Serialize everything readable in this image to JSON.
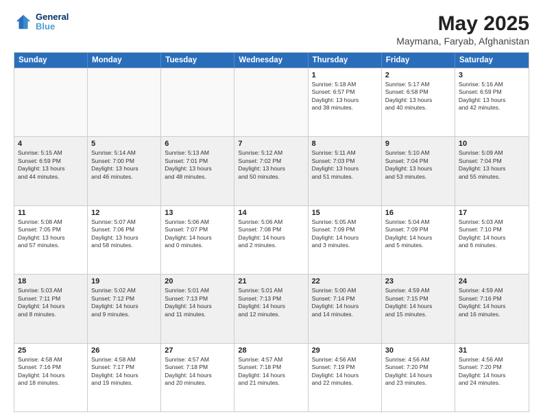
{
  "header": {
    "logo_line1": "General",
    "logo_line2": "Blue",
    "title": "May 2025",
    "subtitle": "Maymana, Faryab, Afghanistan"
  },
  "days_of_week": [
    "Sunday",
    "Monday",
    "Tuesday",
    "Wednesday",
    "Thursday",
    "Friday",
    "Saturday"
  ],
  "weeks": [
    [
      {
        "day": "",
        "text": ""
      },
      {
        "day": "",
        "text": ""
      },
      {
        "day": "",
        "text": ""
      },
      {
        "day": "",
        "text": ""
      },
      {
        "day": "1",
        "text": "Sunrise: 5:18 AM\nSunset: 6:57 PM\nDaylight: 13 hours\nand 38 minutes."
      },
      {
        "day": "2",
        "text": "Sunrise: 5:17 AM\nSunset: 6:58 PM\nDaylight: 13 hours\nand 40 minutes."
      },
      {
        "day": "3",
        "text": "Sunrise: 5:16 AM\nSunset: 6:59 PM\nDaylight: 13 hours\nand 42 minutes."
      }
    ],
    [
      {
        "day": "4",
        "text": "Sunrise: 5:15 AM\nSunset: 6:59 PM\nDaylight: 13 hours\nand 44 minutes."
      },
      {
        "day": "5",
        "text": "Sunrise: 5:14 AM\nSunset: 7:00 PM\nDaylight: 13 hours\nand 46 minutes."
      },
      {
        "day": "6",
        "text": "Sunrise: 5:13 AM\nSunset: 7:01 PM\nDaylight: 13 hours\nand 48 minutes."
      },
      {
        "day": "7",
        "text": "Sunrise: 5:12 AM\nSunset: 7:02 PM\nDaylight: 13 hours\nand 50 minutes."
      },
      {
        "day": "8",
        "text": "Sunrise: 5:11 AM\nSunset: 7:03 PM\nDaylight: 13 hours\nand 51 minutes."
      },
      {
        "day": "9",
        "text": "Sunrise: 5:10 AM\nSunset: 7:04 PM\nDaylight: 13 hours\nand 53 minutes."
      },
      {
        "day": "10",
        "text": "Sunrise: 5:09 AM\nSunset: 7:04 PM\nDaylight: 13 hours\nand 55 minutes."
      }
    ],
    [
      {
        "day": "11",
        "text": "Sunrise: 5:08 AM\nSunset: 7:05 PM\nDaylight: 13 hours\nand 57 minutes."
      },
      {
        "day": "12",
        "text": "Sunrise: 5:07 AM\nSunset: 7:06 PM\nDaylight: 13 hours\nand 58 minutes."
      },
      {
        "day": "13",
        "text": "Sunrise: 5:06 AM\nSunset: 7:07 PM\nDaylight: 14 hours\nand 0 minutes."
      },
      {
        "day": "14",
        "text": "Sunrise: 5:06 AM\nSunset: 7:08 PM\nDaylight: 14 hours\nand 2 minutes."
      },
      {
        "day": "15",
        "text": "Sunrise: 5:05 AM\nSunset: 7:09 PM\nDaylight: 14 hours\nand 3 minutes."
      },
      {
        "day": "16",
        "text": "Sunrise: 5:04 AM\nSunset: 7:09 PM\nDaylight: 14 hours\nand 5 minutes."
      },
      {
        "day": "17",
        "text": "Sunrise: 5:03 AM\nSunset: 7:10 PM\nDaylight: 14 hours\nand 6 minutes."
      }
    ],
    [
      {
        "day": "18",
        "text": "Sunrise: 5:03 AM\nSunset: 7:11 PM\nDaylight: 14 hours\nand 8 minutes."
      },
      {
        "day": "19",
        "text": "Sunrise: 5:02 AM\nSunset: 7:12 PM\nDaylight: 14 hours\nand 9 minutes."
      },
      {
        "day": "20",
        "text": "Sunrise: 5:01 AM\nSunset: 7:13 PM\nDaylight: 14 hours\nand 11 minutes."
      },
      {
        "day": "21",
        "text": "Sunrise: 5:01 AM\nSunset: 7:13 PM\nDaylight: 14 hours\nand 12 minutes."
      },
      {
        "day": "22",
        "text": "Sunrise: 5:00 AM\nSunset: 7:14 PM\nDaylight: 14 hours\nand 14 minutes."
      },
      {
        "day": "23",
        "text": "Sunrise: 4:59 AM\nSunset: 7:15 PM\nDaylight: 14 hours\nand 15 minutes."
      },
      {
        "day": "24",
        "text": "Sunrise: 4:59 AM\nSunset: 7:16 PM\nDaylight: 14 hours\nand 16 minutes."
      }
    ],
    [
      {
        "day": "25",
        "text": "Sunrise: 4:58 AM\nSunset: 7:16 PM\nDaylight: 14 hours\nand 18 minutes."
      },
      {
        "day": "26",
        "text": "Sunrise: 4:58 AM\nSunset: 7:17 PM\nDaylight: 14 hours\nand 19 minutes."
      },
      {
        "day": "27",
        "text": "Sunrise: 4:57 AM\nSunset: 7:18 PM\nDaylight: 14 hours\nand 20 minutes."
      },
      {
        "day": "28",
        "text": "Sunrise: 4:57 AM\nSunset: 7:18 PM\nDaylight: 14 hours\nand 21 minutes."
      },
      {
        "day": "29",
        "text": "Sunrise: 4:56 AM\nSunset: 7:19 PM\nDaylight: 14 hours\nand 22 minutes."
      },
      {
        "day": "30",
        "text": "Sunrise: 4:56 AM\nSunset: 7:20 PM\nDaylight: 14 hours\nand 23 minutes."
      },
      {
        "day": "31",
        "text": "Sunrise: 4:56 AM\nSunset: 7:20 PM\nDaylight: 14 hours\nand 24 minutes."
      }
    ]
  ]
}
